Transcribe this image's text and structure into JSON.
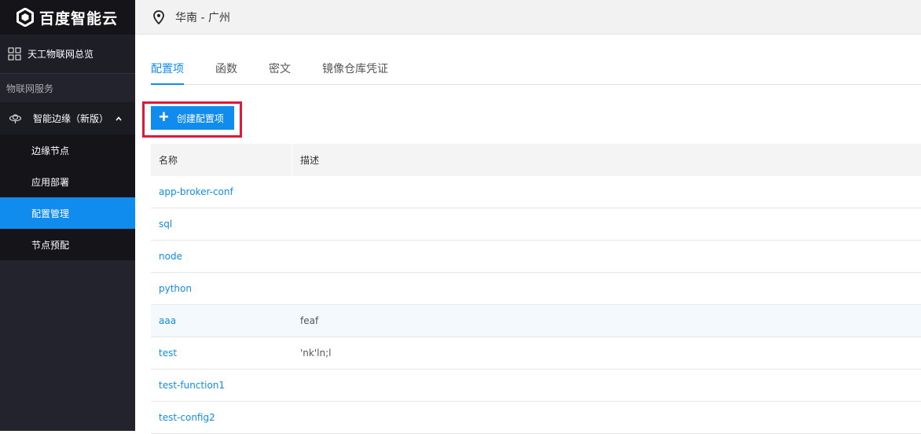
{
  "brand": {
    "logo_text": "百度智能云"
  },
  "sidebar": {
    "overview_label": "天工物联网总览",
    "section_label": "物联网服务",
    "group_label": "智能边缘（新版）",
    "items": [
      {
        "label": "边缘节点",
        "active": false
      },
      {
        "label": "应用部署",
        "active": false
      },
      {
        "label": "配置管理",
        "active": true
      },
      {
        "label": "节点预配",
        "active": false
      }
    ]
  },
  "topbar": {
    "region": "华南 - 广州"
  },
  "tabs": [
    {
      "label": "配置项",
      "active": true
    },
    {
      "label": "函数",
      "active": false
    },
    {
      "label": "密文",
      "active": false
    },
    {
      "label": "镜像仓库凭证",
      "active": false
    }
  ],
  "toolbar": {
    "create_label": "创建配置项",
    "create_icon": "plus-icon"
  },
  "table": {
    "columns": [
      "名称",
      "描述"
    ],
    "rows": [
      {
        "name": "app-broker-conf",
        "desc": ""
      },
      {
        "name": "sql",
        "desc": ""
      },
      {
        "name": "node",
        "desc": ""
      },
      {
        "name": "python",
        "desc": ""
      },
      {
        "name": "aaa",
        "desc": "feaf"
      },
      {
        "name": "test",
        "desc": "'nk'ln;l"
      },
      {
        "name": "test-function1",
        "desc": ""
      },
      {
        "name": "test-config2",
        "desc": ""
      }
    ]
  },
  "colors": {
    "accent": "#108cee",
    "highlight_border": "#e3163c",
    "sidebar_bg": "#23232d"
  }
}
